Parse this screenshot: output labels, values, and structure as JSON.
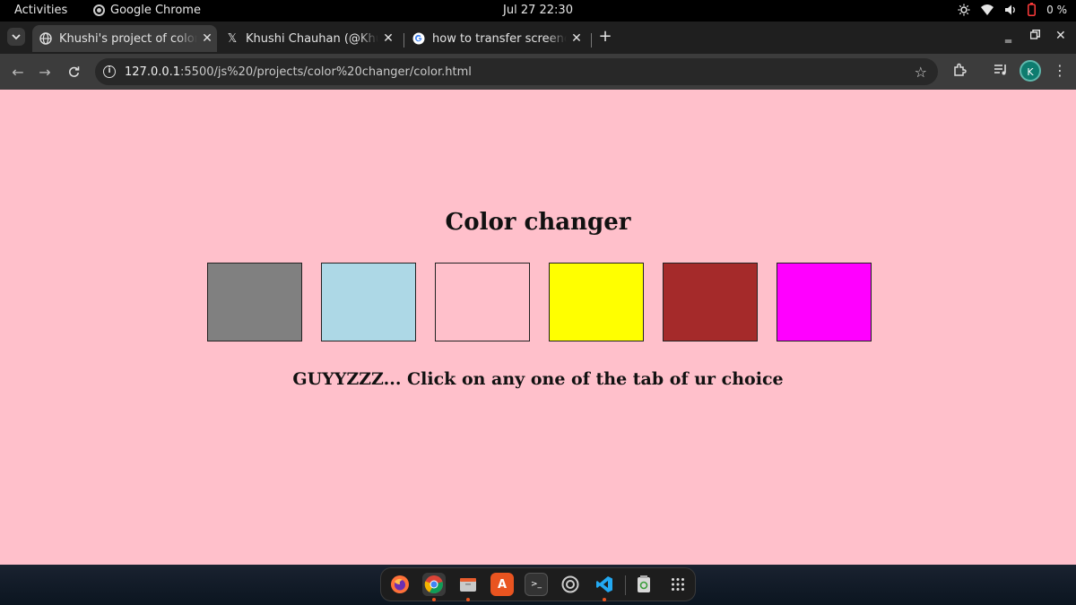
{
  "system_bar": {
    "activities": "Activities",
    "app_name": "Google Chrome",
    "clock": "Jul 27  22:30",
    "battery_percent": "0 %"
  },
  "tabs": [
    {
      "title": "Khushi's project of color",
      "favicon": "globe-icon",
      "active": true
    },
    {
      "title": "Khushi Chauhan (@Khushi",
      "favicon": "x-logo-icon",
      "active": false
    },
    {
      "title": "how to transfer screencast",
      "favicon": "google-g-icon",
      "active": false
    }
  ],
  "toolbar": {
    "url_host": "127.0.0.1",
    "url_path": ":5500/js%20/projects/color%20changer/color.html",
    "profile_initial": "K"
  },
  "page": {
    "heading": "Color changer",
    "swatches": [
      {
        "color": "#808080",
        "name": "grey"
      },
      {
        "color": "#add8e6",
        "name": "lightblue"
      },
      {
        "color": "#ffc0cb",
        "name": "pink"
      },
      {
        "color": "#ffff00",
        "name": "yellow"
      },
      {
        "color": "#a52a2a",
        "name": "brown"
      },
      {
        "color": "#ff00ff",
        "name": "magenta"
      }
    ],
    "note": "GUYYZZZ... Click on any one of the tab of ur choice",
    "background": "#ffc0cb"
  },
  "dock": {
    "apps": [
      "firefox-icon",
      "chrome-icon",
      "files-icon",
      "app-center-icon",
      "terminal-icon",
      "settings-icon",
      "vscode-icon",
      "trash-icon",
      "show-apps-icon"
    ]
  }
}
